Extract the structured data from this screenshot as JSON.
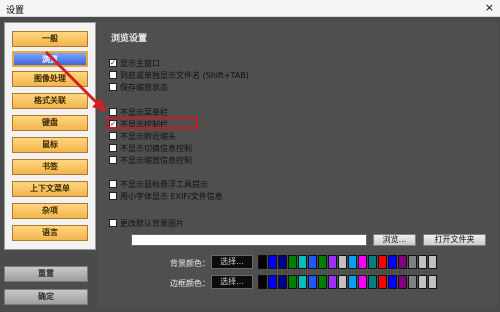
{
  "window": {
    "title": "设置",
    "close": "×"
  },
  "sidebar": {
    "items": [
      {
        "label": "一般"
      },
      {
        "label": "浏览"
      },
      {
        "label": "图像处理"
      },
      {
        "label": "格式关联"
      },
      {
        "label": "键盘"
      },
      {
        "label": "鼠标"
      },
      {
        "label": "书签"
      },
      {
        "label": "上下文菜单"
      },
      {
        "label": "杂项"
      },
      {
        "label": "语言"
      }
    ],
    "bottom": {
      "reset": "重置",
      "ok": "确定"
    }
  },
  "browse": {
    "title": "浏览设置",
    "options": [
      {
        "label": "显示主窗口",
        "checked": "✓"
      },
      {
        "label": "到底或单独显示文件名 (Shift+TAB)",
        "checked": ""
      },
      {
        "label": "保存缩放状态",
        "checked": ""
      },
      {
        "label": "不显示菜单栏",
        "checked": ""
      },
      {
        "label": "不显示控制栏",
        "checked": "✓"
      },
      {
        "label": "不显示附近缩头",
        "checked": ""
      },
      {
        "label": "不显示切换信息控制",
        "checked": ""
      },
      {
        "label": "不显示缩放信息控制",
        "checked": ""
      },
      {
        "label": "不显示鼠标悬浮工具提示",
        "checked": ""
      },
      {
        "label": "用小字体显示 EXIF/文件信息",
        "checked": ""
      },
      {
        "label": "更改默认背景图片",
        "checked": ""
      }
    ],
    "browse_button": "浏览...",
    "open_folder_button": "打开文件夹",
    "background_color_label": "背景颜色：",
    "background_color_value": "选择...",
    "border_color_label": "边框颜色：",
    "border_color_value": "选择..."
  },
  "colors": [
    "#000000",
    "#0000ff",
    "#00008b",
    "#008000",
    "#00bfbf",
    "#1f56ff",
    "#008000",
    "#9b30ff",
    "#c0c0c0",
    "#00a0ff",
    "#ff00ff",
    "#008080",
    "#ff0000",
    "#0000ff",
    "#800080",
    "#808080",
    "#c0c0c0",
    "#c0c0c0"
  ]
}
